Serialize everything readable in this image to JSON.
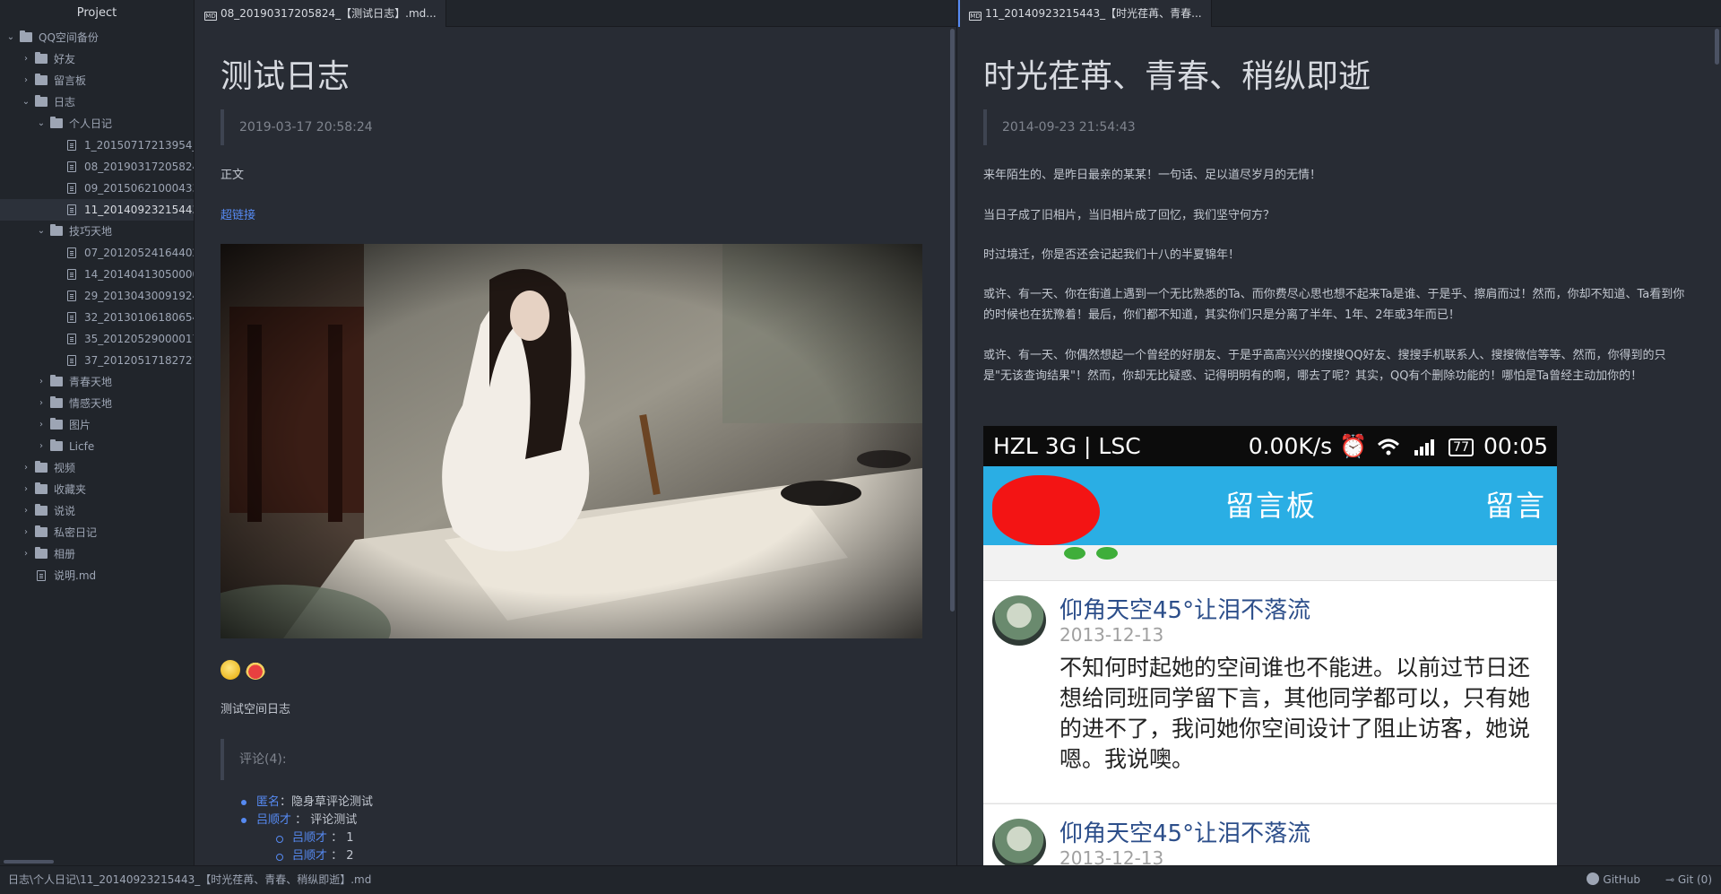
{
  "tree": {
    "title": "Project",
    "items": [
      {
        "label": "QQ空间备份",
        "type": "folder",
        "depth": 0,
        "expanded": true
      },
      {
        "label": "好友",
        "type": "folder",
        "depth": 1,
        "expanded": false
      },
      {
        "label": "留言板",
        "type": "folder",
        "depth": 1,
        "expanded": false
      },
      {
        "label": "日志",
        "type": "folder",
        "depth": 1,
        "expanded": true
      },
      {
        "label": "个人日记",
        "type": "folder",
        "depth": 2,
        "expanded": true
      },
      {
        "label": "1_20150717213954_",
        "type": "file",
        "depth": 3
      },
      {
        "label": "08_20190317205824_",
        "type": "file",
        "depth": 3
      },
      {
        "label": "09_20150621000433_",
        "type": "file",
        "depth": 3
      },
      {
        "label": "11_20140923215443_",
        "type": "file",
        "depth": 3,
        "selected": true
      },
      {
        "label": "技巧天地",
        "type": "folder",
        "depth": 2,
        "expanded": true
      },
      {
        "label": "07_20120524164402_",
        "type": "file",
        "depth": 3
      },
      {
        "label": "14_20140413050000_",
        "type": "file",
        "depth": 3
      },
      {
        "label": "29_20130430091924_",
        "type": "file",
        "depth": 3
      },
      {
        "label": "32_20130106180654_",
        "type": "file",
        "depth": 3
      },
      {
        "label": "35_20120529000017_",
        "type": "file",
        "depth": 3
      },
      {
        "label": "37_20120517182721_",
        "type": "file",
        "depth": 3
      },
      {
        "label": "青春天地",
        "type": "folder",
        "depth": 2,
        "expanded": false
      },
      {
        "label": "情感天地",
        "type": "folder",
        "depth": 2,
        "expanded": false
      },
      {
        "label": "图片",
        "type": "folder",
        "depth": 2,
        "expanded": false
      },
      {
        "label": "Licfe",
        "type": "folder",
        "depth": 2,
        "expanded": false
      },
      {
        "label": "视频",
        "type": "folder",
        "depth": 1,
        "expanded": false
      },
      {
        "label": "收藏夹",
        "type": "folder",
        "depth": 1,
        "expanded": false
      },
      {
        "label": "说说",
        "type": "folder",
        "depth": 1,
        "expanded": false
      },
      {
        "label": "私密日记",
        "type": "folder",
        "depth": 1,
        "expanded": false
      },
      {
        "label": "相册",
        "type": "folder",
        "depth": 1,
        "expanded": false
      },
      {
        "label": "说明.md",
        "type": "file",
        "depth": 1
      }
    ]
  },
  "left": {
    "tab": "08_20190317205824_【测试日志】.md...",
    "tab_icon": "MD",
    "title": "测试日志",
    "date": "2019-03-17 20:58:24",
    "body": "正文",
    "link": "超链接",
    "caption": "测试空间日志",
    "comments_header": "评论(4):",
    "comments": [
      {
        "author": "匿名",
        "sep": "：",
        "text": "隐身草评论测试",
        "level": 0
      },
      {
        "author": "吕顺才",
        "sep": " ： ",
        "text": "评论测试",
        "level": 0
      },
      {
        "author": "吕顺才",
        "sep": " ： ",
        "text": "1",
        "level": 1
      },
      {
        "author": "吕顺才",
        "sep": " ： ",
        "text": "2",
        "level": 1
      }
    ]
  },
  "right": {
    "tab": "11_20140923215443_【时光荏苒、青春...",
    "tab_icon": "MD",
    "title": "时光荏苒、青春、稍纵即逝",
    "date": "2014-09-23 21:54:43",
    "paragraphs": [
      "来年陌生的、是昨日最亲的某某！一句话、足以道尽岁月的无情！",
      "当日子成了旧相片，当旧相片成了回忆，我们坚守何方？",
      "时过境迁，你是否还会记起我们十八的半夏锦年！",
      "或许、有一天、你在街道上遇到一个无比熟悉的Ta、而你费尽心思也想不起来Ta是谁、于是乎、擦肩而过！然而，你却不知道、Ta看到你的时候也在犹豫着！最后，你们都不知道，其实你们只是分离了半年、1年、2年或3年而已！",
      "或许、有一天、你偶然想起一个曾经的好朋友、于是乎高高兴兴的搜搜QQ好友、搜搜手机联系人、搜搜微信等等、然而，你得到的只是\"无该查询结果\"！然而，你却无比疑惑、记得明明有的啊，哪去了呢？其实，QQ有个删除功能的！哪怕是Ta曾经主动加你的！"
    ],
    "phone": {
      "carrier": "HZL 3G | LSC",
      "speed": "0.00K/s",
      "battery": "77",
      "time": "00:05",
      "header_title": "留言板",
      "header_button": "留言",
      "posts": [
        {
          "name": "仰角天空45°让泪不落流",
          "date": "2013-12-13",
          "message": "不知何时起她的空间谁也不能进。以前过节日还想给同班同学留下言，其他同学都可以，只有她的进不了，我问她你空间设计了阻止访客，她说嗯。我说噢。"
        },
        {
          "name": "仰角天空45°让泪不落流",
          "date": "2013-12-13",
          "message": ""
        }
      ]
    }
  },
  "status": {
    "path": "日志\\个人日记\\11_20140923215443_【时光荏苒、青春、稍纵即逝】.md",
    "github": "GitHub",
    "git": "Git (0)"
  },
  "colors": {
    "background": "#282c34",
    "panel": "#21252b",
    "link": "#568af2",
    "phone_header": "#2aaee4"
  }
}
